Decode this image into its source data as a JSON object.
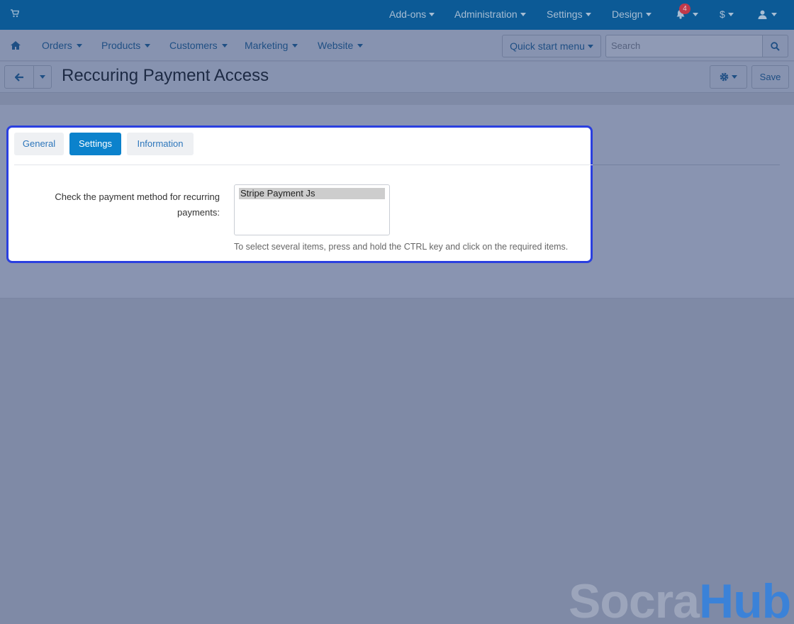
{
  "top_nav": {
    "addons": "Add-ons",
    "administration": "Administration",
    "settings": "Settings",
    "design": "Design",
    "notifications_count": "4",
    "currency": "$"
  },
  "main_nav": {
    "items": [
      "Orders",
      "Products",
      "Customers",
      "Marketing",
      "Website"
    ],
    "quick_start": "Quick start menu",
    "search_placeholder": "Search"
  },
  "title_bar": {
    "title": "Reccuring Payment Access",
    "save": "Save"
  },
  "tabs": [
    "General",
    "Settings",
    "Information"
  ],
  "active_tab": "Settings",
  "settings_form": {
    "label": "Check the payment method for recurring payments:",
    "options": [
      "Stripe Payment Js"
    ],
    "help": "To select several items, press and hold the CTRL key and click on the required items."
  },
  "watermark": {
    "part1": "Socra",
    "part2": "Hub"
  },
  "colors": {
    "topbar": "#0c5a96",
    "accent": "#0b82cc",
    "focus_outline": "#2a3fe0",
    "badge": "#c0394a"
  },
  "icons": [
    "cart-icon",
    "bell-icon",
    "user-icon",
    "home-icon",
    "search-icon",
    "arrow-left-icon",
    "gear-icon"
  ]
}
